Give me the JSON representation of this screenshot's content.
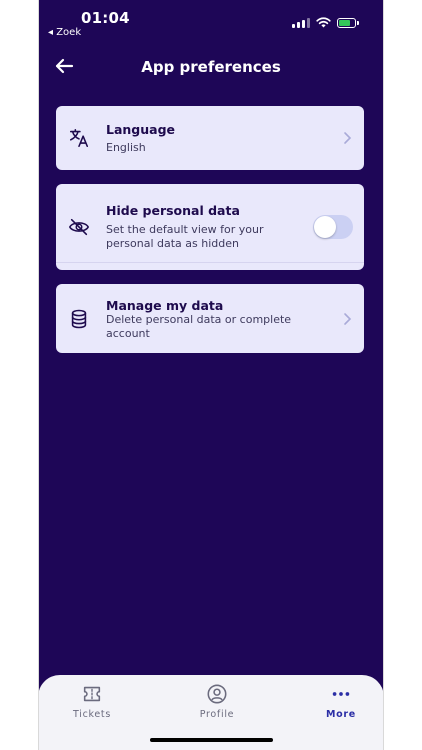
{
  "status_bar": {
    "time": "01:04",
    "back_app": "◂ Zoek"
  },
  "header": {
    "title": "App preferences"
  },
  "language": {
    "label": "Language",
    "value": "English"
  },
  "hide_personal": {
    "label": "Hide personal data",
    "description": "Set the default view for your personal data as hidden",
    "enabled": false
  },
  "manage_data": {
    "label": "Manage my data",
    "description": "Delete personal data or complete account"
  },
  "tabs": [
    {
      "label": "Tickets",
      "icon": "ticket-icon",
      "active": false
    },
    {
      "label": "Profile",
      "icon": "profile-icon",
      "active": false
    },
    {
      "label": "More",
      "icon": "more-dots-icon",
      "active": true
    }
  ],
  "colors": {
    "background": "#1e0657",
    "card": "#e9e8fb",
    "accent": "#2b2ea6",
    "battery": "#34c759"
  }
}
